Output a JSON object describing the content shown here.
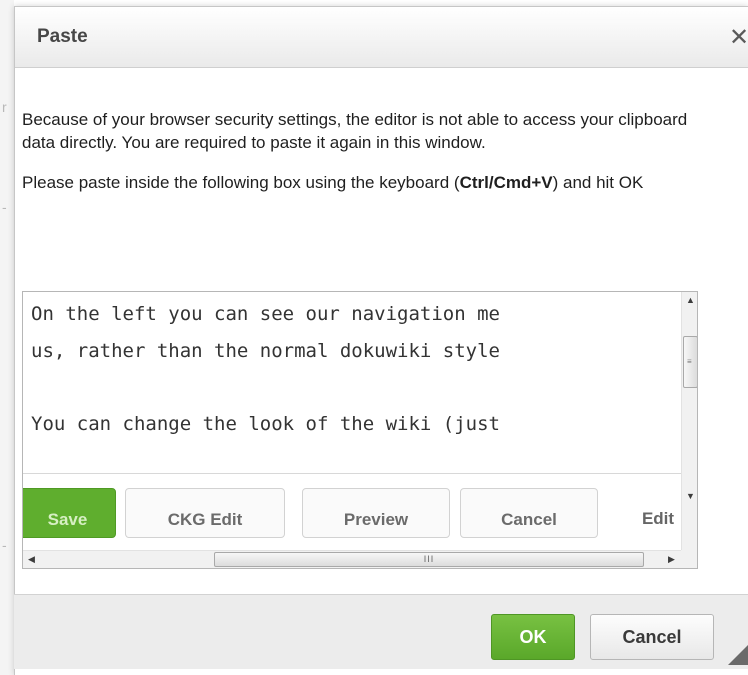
{
  "dialog": {
    "title": "Paste",
    "close_glyph": "✕",
    "instructions": "Because of your browser security settings, the editor is not able to access your clipboard data directly. You are required to paste it again in this window.",
    "paste_hint_prefix": "Please paste inside the following box using the keyboard (",
    "paste_hint_shortcut": "Ctrl/Cmd+V",
    "paste_hint_suffix": ") and hit OK"
  },
  "paste_area": {
    "lines": [
      "On the left you can see our navigation me",
      "us, rather than the normal dokuwiki style",
      "",
      "You can change the look of the wiki (just"
    ],
    "embedded_buttons": [
      "Save",
      "CKG Edit",
      "Preview",
      "Cancel",
      "Edit"
    ]
  },
  "footer": {
    "ok_label": "OK",
    "cancel_label": "Cancel"
  },
  "icons": {
    "close": "close-icon",
    "scroll_up": "scroll-up-icon",
    "scroll_down": "scroll-down-icon",
    "scroll_left": "scroll-left-icon",
    "scroll_right": "scroll-right-icon",
    "resize": "resize-grip-icon"
  },
  "colors": {
    "primary_button": "#5fae2e",
    "header_text": "#474747"
  }
}
